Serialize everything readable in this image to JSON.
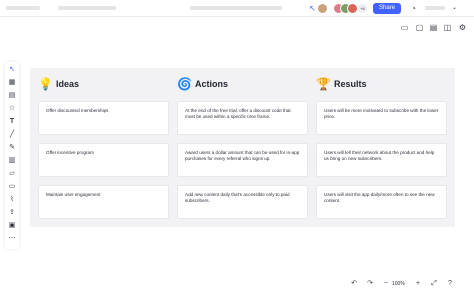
{
  "toolbar": {
    "share_label": "Share",
    "collaborator_count": "+6"
  },
  "columns": [
    {
      "emoji": "💡",
      "title": "Ideas",
      "cards": [
        "Offer discounted memberships",
        "Offer incentive program",
        "Maintain user engagement"
      ]
    },
    {
      "emoji": "🌀",
      "title": "Actions",
      "cards": [
        "At the end of the free trial, offer a discount code that must be used within a specific time frame.",
        "Award users a dollar amount that can be used for in-app purchases for every referral who signs up.",
        "Add new content daily that's accessible only to paid subscribers."
      ]
    },
    {
      "emoji": "🏆",
      "title": "Results",
      "cards": [
        "Users will be more motivated to subscribe with the lower price.",
        "Users will tell their network about the product and help us bring on new subscribers.",
        "Users will visit the app daily/more often to see the new content."
      ]
    }
  ],
  "bottombar": {
    "zoom_level": "100%"
  },
  "colors": {
    "accent": "#4262ff",
    "board_bg": "#f2f2f4"
  }
}
